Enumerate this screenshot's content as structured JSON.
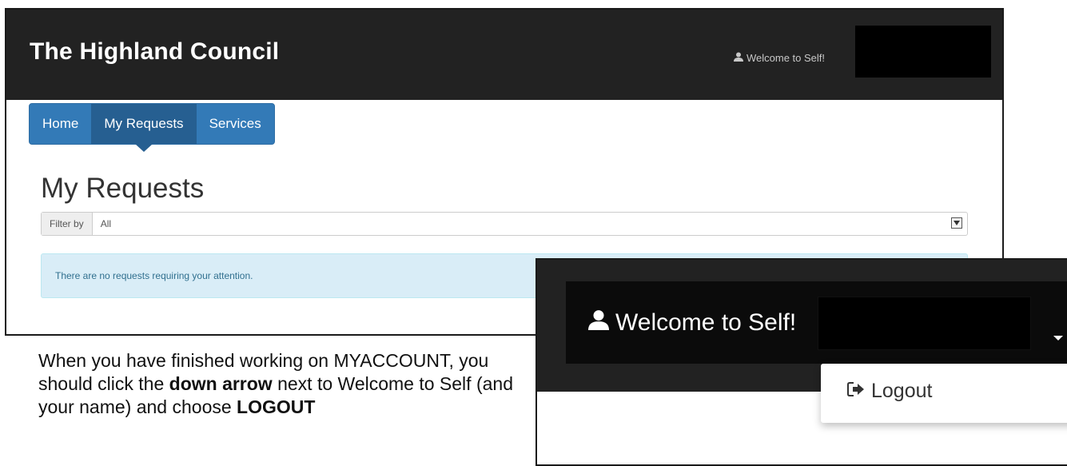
{
  "header": {
    "site_title": "The Highland Council",
    "welcome_text": "Welcome to Self!"
  },
  "nav": {
    "tabs": [
      {
        "label": "Home",
        "active": false
      },
      {
        "label": "My Requests",
        "active": true
      },
      {
        "label": "Services",
        "active": false
      }
    ]
  },
  "main": {
    "page_title": "My Requests",
    "filter_label": "Filter by",
    "filter_value": "All",
    "alert_text": "There are no requests requiring your attention."
  },
  "instruction": {
    "part1": "When you have finished working on MYACCOUNT, you should click the ",
    "bold1": "down arrow",
    "part2": " next to Welcome to Self (and your name) and choose ",
    "bold2": "LOGOUT"
  },
  "zoom": {
    "welcome_text": "Welcome to Self!",
    "logout_label": "Logout"
  },
  "colors": {
    "header_bg": "#222222",
    "nav_blue": "#337ab7",
    "nav_active": "#265f91",
    "alert_bg": "#d9edf7"
  }
}
